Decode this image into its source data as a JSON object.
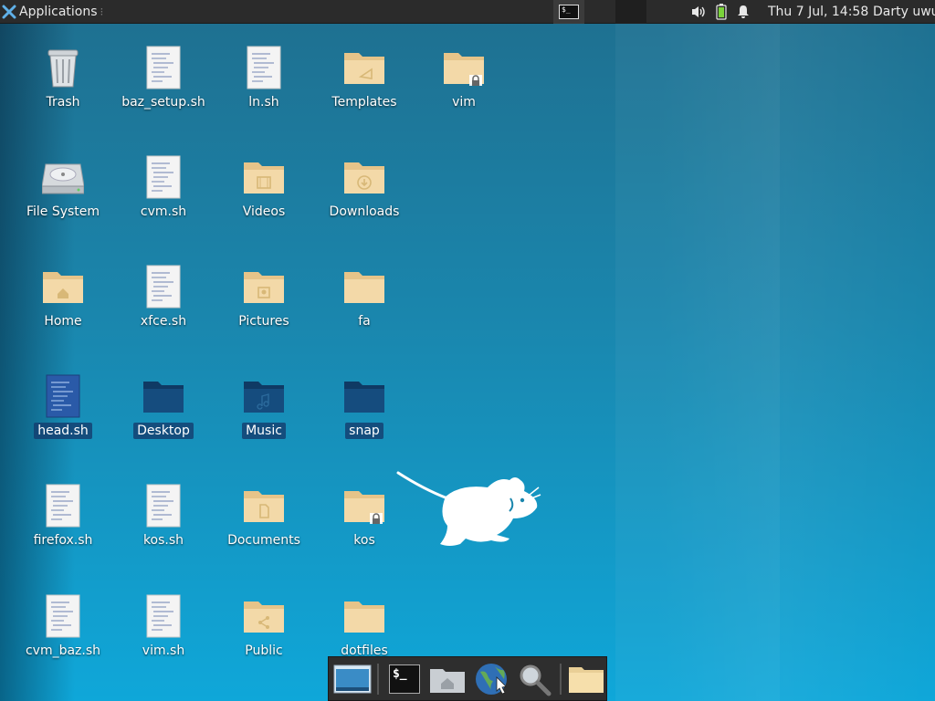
{
  "top_panel": {
    "applications_label": "Applications",
    "separator": "⁝",
    "clock": "Thu  7 Jul, 14:58",
    "user": "Darty uwu",
    "tray_icons": [
      "volume-icon",
      "battery-icon",
      "notification-bell-icon"
    ]
  },
  "tasklist": [
    {
      "name": "terminal-task",
      "state": "active"
    },
    {
      "name": "empty-task-1",
      "state": "normal"
    },
    {
      "name": "empty-task-2",
      "state": "dark"
    }
  ],
  "desktop": {
    "icons": [
      {
        "label": "Trash",
        "type": "trash",
        "col": 0,
        "row": 0
      },
      {
        "label": "baz_setup.sh",
        "type": "script",
        "col": 1,
        "row": 0
      },
      {
        "label": "ln.sh",
        "type": "script",
        "col": 2,
        "row": 0
      },
      {
        "label": "Templates",
        "type": "folder-templates",
        "col": 3,
        "row": 0
      },
      {
        "label": "vim",
        "type": "folder-locked",
        "col": 4,
        "row": 0
      },
      {
        "label": "File System",
        "type": "drive",
        "col": 0,
        "row": 1
      },
      {
        "label": "cvm.sh",
        "type": "script",
        "col": 1,
        "row": 1
      },
      {
        "label": "Videos",
        "type": "folder-videos",
        "col": 2,
        "row": 1
      },
      {
        "label": "Downloads",
        "type": "folder-downloads",
        "col": 3,
        "row": 1
      },
      {
        "label": "Home",
        "type": "folder-home",
        "col": 0,
        "row": 2
      },
      {
        "label": "xfce.sh",
        "type": "script",
        "col": 1,
        "row": 2
      },
      {
        "label": "Pictures",
        "type": "folder-pictures",
        "col": 2,
        "row": 2
      },
      {
        "label": "fa",
        "type": "folder",
        "col": 3,
        "row": 2
      },
      {
        "label": "head.sh",
        "type": "script",
        "col": 0,
        "row": 3,
        "selected": true
      },
      {
        "label": "Desktop",
        "type": "folder",
        "col": 1,
        "row": 3,
        "selected": true
      },
      {
        "label": "Music",
        "type": "folder-music",
        "col": 2,
        "row": 3,
        "selected": true
      },
      {
        "label": "snap",
        "type": "folder",
        "col": 3,
        "row": 3,
        "selected": true
      },
      {
        "label": "firefox.sh",
        "type": "script",
        "col": 0,
        "row": 4
      },
      {
        "label": "kos.sh",
        "type": "script",
        "col": 1,
        "row": 4
      },
      {
        "label": "Documents",
        "type": "folder-documents",
        "col": 2,
        "row": 4
      },
      {
        "label": "kos",
        "type": "folder-locked",
        "col": 3,
        "row": 4
      },
      {
        "label": "cvm_baz.sh",
        "type": "script",
        "col": 0,
        "row": 5
      },
      {
        "label": "vim.sh",
        "type": "script",
        "col": 1,
        "row": 5
      },
      {
        "label": "Public",
        "type": "folder-public",
        "col": 2,
        "row": 5
      },
      {
        "label": "dotfiles",
        "type": "folder",
        "col": 3,
        "row": 5
      }
    ]
  },
  "dock": {
    "items": [
      {
        "name": "show-desktop-launcher",
        "icon": "show-desktop-icon"
      },
      {
        "name": "terminal-launcher",
        "icon": "terminal-icon",
        "text": "$_"
      },
      {
        "name": "home-folder-launcher",
        "icon": "home-folder-icon"
      },
      {
        "name": "web-browser-launcher",
        "icon": "globe-icon"
      },
      {
        "name": "app-finder-launcher",
        "icon": "magnifier-icon"
      },
      {
        "name": "folder-launcher",
        "icon": "folder-icon"
      }
    ]
  },
  "colors": {
    "panel_bg": "#2b2b2b",
    "folder": "#f3d9a8",
    "selection": "#143c6e",
    "desktop_top": "#1f6f8f",
    "desktop_bottom": "#0fa7d9"
  }
}
